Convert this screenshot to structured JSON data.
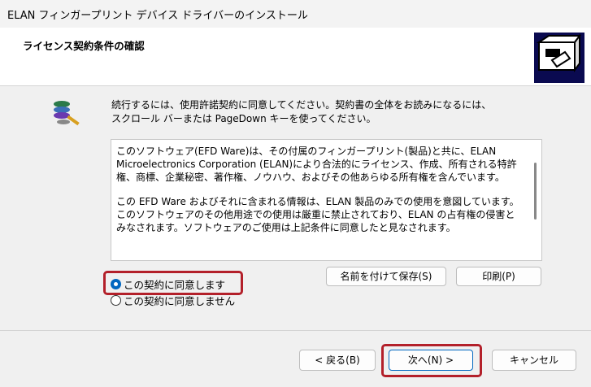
{
  "window": {
    "title": "ELAN フィンガープリント デバイス ドライバーのインストール"
  },
  "header": {
    "title": "ライセンス契約条件の確認"
  },
  "instructions": {
    "line1": "続行するには、使用許諾契約に同意してください。契約書の全体をお読みになるには、",
    "line2": "スクロール バーまたは PageDown キーを使ってください。"
  },
  "license": {
    "paragraph1": "このソフトウェア(EFD Ware)は、その付属のフィンガープリント(製品)と共に、ELAN Microelectronics Corporation (ELAN)により合法的にライセンス、作成、所有される特許権、商標、企業秘密、著作権、ノウハウ、およびその他あらゆる所有権を含んでいます。",
    "paragraph2": "この EFD Ware およびそれに含まれる情報は、ELAN 製品のみでの使用を意図しています。このソフトウェアのその他用途での使用は厳重に禁止されており、ELAN の占有権の侵害とみなされます。ソフトウェアのご使用は上記条件に同意したと見なされます。"
  },
  "buttons": {
    "save": "名前を付けて保存(S)",
    "print": "印刷(P)",
    "back": "< 戻る(B)",
    "next": "次へ(N) >",
    "cancel": "キャンセル"
  },
  "options": {
    "agree": "この契約に同意します",
    "disagree": "この契約に同意しません",
    "selected": "agree"
  },
  "colors": {
    "highlight": "#b3202a",
    "accent": "#0067c0"
  }
}
